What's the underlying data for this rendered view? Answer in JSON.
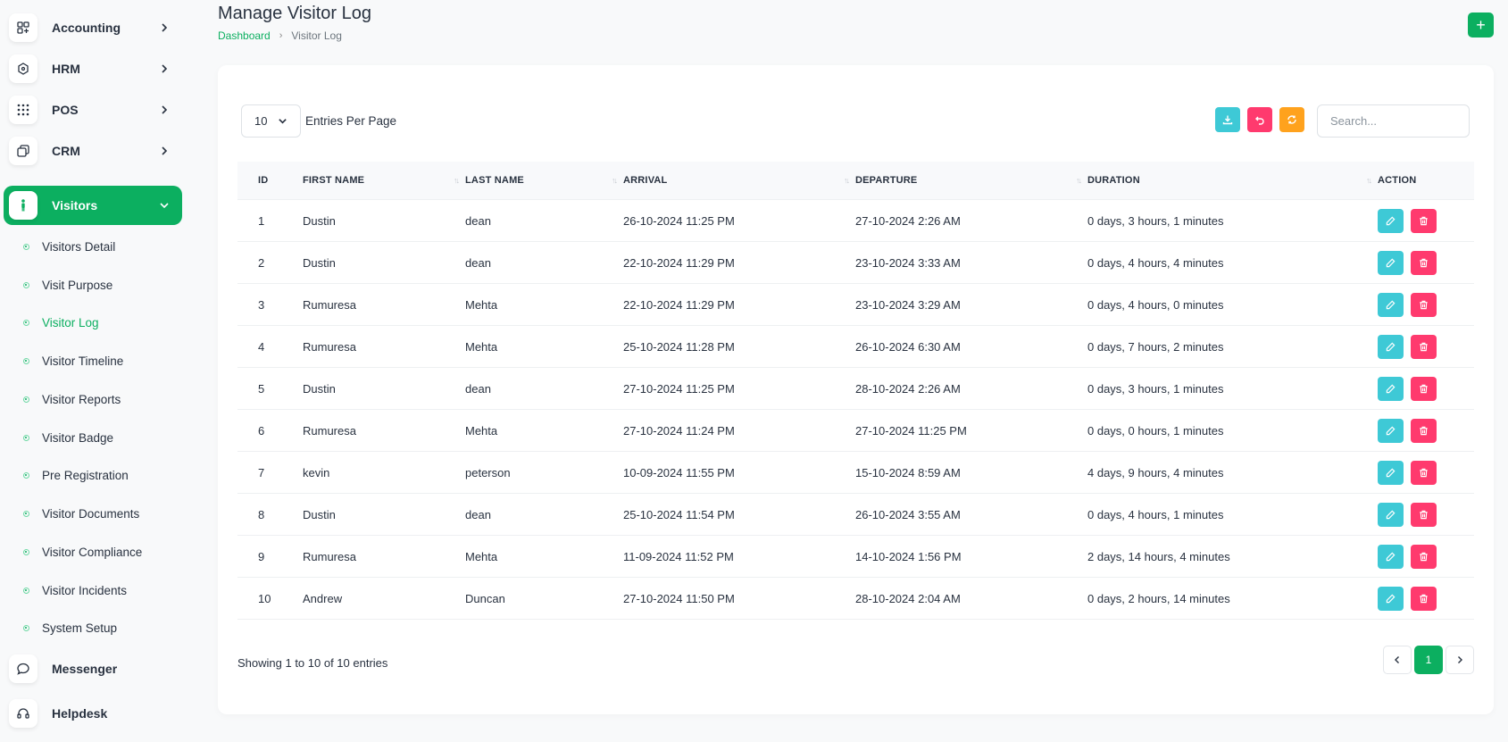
{
  "sidebar": {
    "nav": [
      {
        "label": "Accounting",
        "icon": "grid-plus-icon"
      },
      {
        "label": "HRM",
        "icon": "hexagon-icon"
      },
      {
        "label": "POS",
        "icon": "dots-grid-icon"
      },
      {
        "label": "CRM",
        "icon": "layers-icon"
      },
      {
        "label": "Visitors",
        "icon": "person-icon"
      }
    ],
    "sub_items": [
      "Visitors Detail",
      "Visit Purpose",
      "Visitor Log",
      "Visitor Timeline",
      "Visitor Reports",
      "Visitor Badge",
      "Pre Registration",
      "Visitor Documents",
      "Visitor Compliance",
      "Visitor Incidents",
      "System Setup"
    ],
    "bottom_nav": [
      {
        "label": "Messenger",
        "icon": "chat-icon"
      },
      {
        "label": "Helpdesk",
        "icon": "headset-icon"
      }
    ]
  },
  "header": {
    "title": "Manage Visitor Log",
    "breadcrumb": {
      "home": "Dashboard",
      "current": "Visitor Log"
    },
    "add_label": "+"
  },
  "toolbar": {
    "entries_value": "10",
    "entries_label": "Entries Per Page",
    "search_placeholder": "Search..."
  },
  "colors": {
    "primary": "#0caf60",
    "info": "#3ec9d6",
    "danger": "#ff3a6e",
    "warning": "#ffa21d"
  },
  "table": {
    "columns": [
      "ID",
      "FIRST NAME",
      "LAST NAME",
      "ARRIVAL",
      "DEPARTURE",
      "DURATION",
      "ACTION"
    ],
    "rows": [
      {
        "id": "1",
        "first": "Dustin",
        "last": "dean",
        "arrival": "26-10-2024 11:25 PM",
        "departure": "27-10-2024 2:26 AM",
        "duration": "0 days, 3 hours, 1 minutes"
      },
      {
        "id": "2",
        "first": "Dustin",
        "last": "dean",
        "arrival": "22-10-2024 11:29 PM",
        "departure": "23-10-2024 3:33 AM",
        "duration": "0 days, 4 hours, 4 minutes"
      },
      {
        "id": "3",
        "first": "Rumuresa",
        "last": "Mehta",
        "arrival": "22-10-2024 11:29 PM",
        "departure": "23-10-2024 3:29 AM",
        "duration": "0 days, 4 hours, 0 minutes"
      },
      {
        "id": "4",
        "first": "Rumuresa",
        "last": "Mehta",
        "arrival": "25-10-2024 11:28 PM",
        "departure": "26-10-2024 6:30 AM",
        "duration": "0 days, 7 hours, 2 minutes"
      },
      {
        "id": "5",
        "first": "Dustin",
        "last": "dean",
        "arrival": "27-10-2024 11:25 PM",
        "departure": "28-10-2024 2:26 AM",
        "duration": "0 days, 3 hours, 1 minutes"
      },
      {
        "id": "6",
        "first": "Rumuresa",
        "last": "Mehta",
        "arrival": "27-10-2024 11:24 PM",
        "departure": "27-10-2024 11:25 PM",
        "duration": "0 days, 0 hours, 1 minutes"
      },
      {
        "id": "7",
        "first": "kevin",
        "last": "peterson",
        "arrival": "10-09-2024 11:55 PM",
        "departure": "15-10-2024 8:59 AM",
        "duration": "4 days, 9 hours, 4 minutes"
      },
      {
        "id": "8",
        "first": "Dustin",
        "last": "dean",
        "arrival": "25-10-2024 11:54 PM",
        "departure": "26-10-2024 3:55 AM",
        "duration": "0 days, 4 hours, 1 minutes"
      },
      {
        "id": "9",
        "first": "Rumuresa",
        "last": "Mehta",
        "arrival": "11-09-2024 11:52 PM",
        "departure": "14-10-2024 1:56 PM",
        "duration": "2 days, 14 hours, 4 minutes"
      },
      {
        "id": "10",
        "first": "Andrew",
        "last": "Duncan",
        "arrival": "27-10-2024 11:50 PM",
        "departure": "28-10-2024 2:04 AM",
        "duration": "0 days, 2 hours, 14 minutes"
      }
    ]
  },
  "footer": {
    "showing": "Showing 1 to 10 of 10 entries",
    "current_page": "1"
  }
}
